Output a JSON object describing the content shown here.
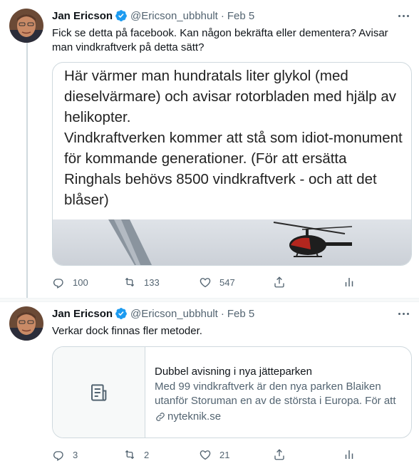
{
  "tweets": [
    {
      "author_name": "Jan Ericson",
      "handle": "@Ericson_ubbhult",
      "separator": "·",
      "date": "Feb 5",
      "text": "Fick se detta på facebook. Kan någon bekräfta eller dementera? Avisar man vindkraftverk på detta sätt?",
      "media_text": "Här värmer man hundratals liter glykol (med dieselvärmare) och avisar rotorbladen med hjälp av helikopter.\nVindkraftverken kommer att stå som idiot-monument för kommande generationer. (För att ersätta Ringhals behövs 8500 vindkraftverk - och att det blåser)",
      "replies": "100",
      "retweets": "133",
      "likes": "547"
    },
    {
      "author_name": "Jan Ericson",
      "handle": "@Ericson_ubbhult",
      "separator": "·",
      "date": "Feb 5",
      "text": "Verkar dock finnas fler metoder.",
      "card": {
        "title": "Dubbel avisning i nya jätteparken",
        "description": "Med 99 vindkraftverk är den nya parken Blaiken utanför Storuman en av de största i Europa. För att …",
        "domain": "nyteknik.se"
      },
      "replies": "3",
      "retweets": "2",
      "likes": "21"
    }
  ],
  "colors": {
    "text": "#0f1419",
    "secondary": "#536471",
    "border": "#cfd9de",
    "verified": "#1d9bf0"
  },
  "icons": [
    "more-icon",
    "verified-badge-icon",
    "reply-icon",
    "retweet-icon",
    "like-icon",
    "share-icon",
    "analytics-icon",
    "article-icon",
    "link-icon"
  ]
}
